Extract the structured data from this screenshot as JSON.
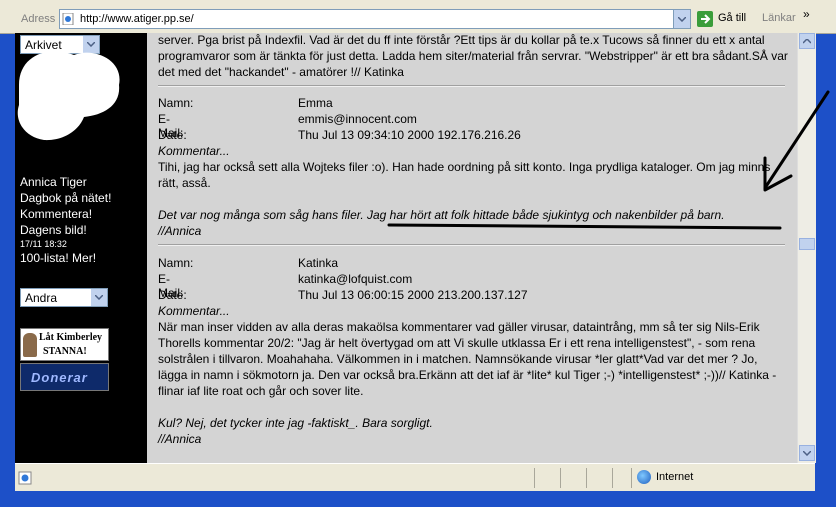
{
  "address_bar": {
    "label": "Adress",
    "url": "http://www.atiger.pp.se/",
    "go_label": "Gå till",
    "links_label": "Länkar",
    "chevron": "»"
  },
  "sidebar": {
    "archive_select": "Arkivet",
    "nav": [
      "Annica Tiger",
      "Dagbok på nätet!",
      "Kommentera!",
      "Dagens bild!",
      "17/11 18:32",
      "100-lista! Mer!"
    ],
    "other_select": "Andra",
    "banner1_line1": "Låt Kimberley",
    "banner1_line2": "STANNA!",
    "banner2_text": "Donerar"
  },
  "content": {
    "intro": "server. Pga brist på Indexfil. Vad är det du ff inte förstår ?Ett tips är du kollar på te.x Tucows så finner du ett x antal programvaror som är tänkta för just detta. Ladda hem siter/material från servrar. \"Webstripper\" är ett bra sådant.SÅ var det med det \"hackandet\" - amatörer !// Katinka",
    "entries": [
      {
        "name_label": "Namn:",
        "name": "Emma",
        "email_label": "E-Mail:",
        "email": "emmis@innocent.com",
        "date_label": "Date:",
        "date": "Thu Jul 13 09:34:10 2000 192.176.216.26",
        "kommentar": "Kommentar...",
        "body": "Tihi, jag har också sett alla Wojteks filer :o). Han hade oordning på sitt konto. Inga prydliga kataloger. Om jag minns rätt, asså.",
        "reply": "Det var nog många som såg hans filer. Jag har hört att folk hittade både sjukintyg och nakenbilder på barn.",
        "signature": "//Annica"
      },
      {
        "name_label": "Namn:",
        "name": "Katinka",
        "email_label": "E-Mail:",
        "email": "katinka@lofquist.com",
        "date_label": "Date:",
        "date": "Thu Jul 13 06:00:15 2000 213.200.137.127",
        "kommentar": "Kommentar...",
        "body": "När man inser vidden av alla deras makaölsa kommentarer vad gäller virusar, dataintrång, mm så ter sig Nils-Erik Thorells kommentar 20/2: \"Jag är helt övertygad om att Vi skulle utklassa Er i ett rena intelligenstest\", - som rena solstrålen i tillvaron. Moahahaha. Välkommen in i matchen. Namnsökande virusar *ler glatt*Vad var det mer ? Jo, lägga in namn i sökmotorn ja. Den var också bra.Erkänn att det iaf är *lite* kul Tiger ;-) *intelligenstest* ;-))// Katinka - flinar iaf lite roat och går och sover lite.",
        "reply": "Kul? Nej, det tycker inte jag -faktiskt_. Bara sorgligt.",
        "signature": "//Annica"
      }
    ]
  },
  "status_bar": {
    "zone": "Internet"
  },
  "colors": {
    "content_bg": "#d4d4d4",
    "sidebar_bg": "#000000",
    "frame_blue": "#1d50c8"
  }
}
